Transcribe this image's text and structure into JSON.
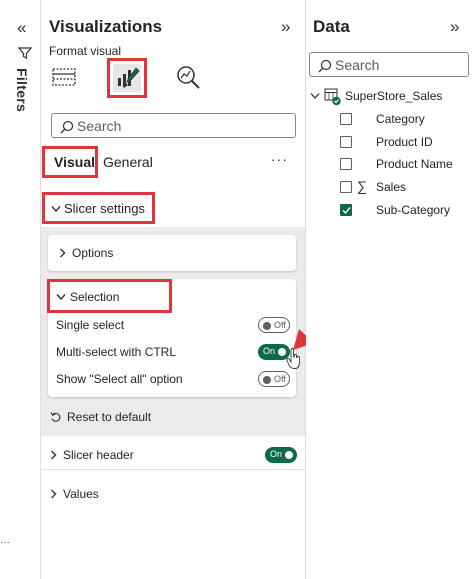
{
  "filters": {
    "label": "Filters",
    "collapse_glyph": "«"
  },
  "visualizations": {
    "title": "Visualizations",
    "expand_glyph": "»",
    "format_visual_label": "Format visual",
    "search_placeholder": "Search",
    "tabs": {
      "visual": "Visual",
      "general": "General"
    },
    "more_glyph": "···",
    "slicer_settings": "Slicer settings",
    "options": "Options",
    "selection": "Selection",
    "single_select": "Single select",
    "multi_select": "Multi-select with CTRL",
    "show_select_all": "Show \"Select all\" option",
    "toggle_off": "Off",
    "toggle_on": "On",
    "reset": "Reset to default",
    "slicer_header": "Slicer header",
    "values": "Values"
  },
  "data_pane": {
    "title": "Data",
    "expand_glyph": "»",
    "search_placeholder": "Search",
    "table_name": "SuperStore_Sales",
    "fields": [
      {
        "name": "Category",
        "checked": false,
        "sigma": false
      },
      {
        "name": "Product ID",
        "checked": false,
        "sigma": false
      },
      {
        "name": "Product Name",
        "checked": false,
        "sigma": false
      },
      {
        "name": "Sales",
        "checked": false,
        "sigma": true
      },
      {
        "name": "Sub-Category",
        "checked": true,
        "sigma": false
      }
    ],
    "sigma_glyph": "∑"
  },
  "colors": {
    "accent": "#0e6a4c",
    "highlight": "#e0353d",
    "gray": "#ebebeb"
  }
}
